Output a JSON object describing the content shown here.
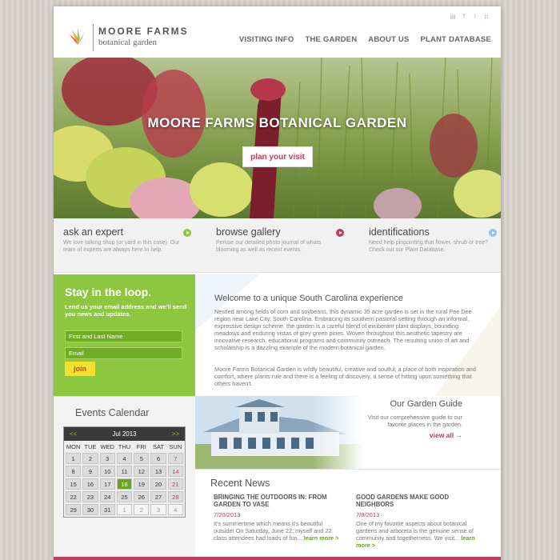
{
  "brand": {
    "title": "MOORE FARMS",
    "subtitle": "botanical garden"
  },
  "social": [
    "rss-icon",
    "facebook-icon",
    "twitter-icon",
    "pinterest-icon"
  ],
  "nav": [
    "VISITING INFO",
    "THE GARDEN",
    "ABOUT US",
    "PLANT DATABASE"
  ],
  "hero": {
    "title": "MOORE FARMS BOTANICAL GARDEN",
    "button": "plan your visit"
  },
  "features": [
    {
      "title": "ask an expert",
      "text": "We love talking shop (or yard in this case). Our team of experts are always here to help.",
      "color": "#8dc63f"
    },
    {
      "title": "browse gallery",
      "text": "Peruse our detailed photo journal of whats blooming as well as recent events.",
      "color": "#c33a5a"
    },
    {
      "title": "identifications",
      "text": "Need help pinpointing that flower, shrub or tree? Check out our Plant Database.",
      "color": "#8ec5e8"
    }
  ],
  "signup": {
    "title": "Stay in the loop.",
    "text": "Lend us your email address and we'll send you news and updates.",
    "name_placeholder": "First and Last Name",
    "email_placeholder": "Email",
    "button": "join"
  },
  "events": {
    "title": "Events Calendar",
    "month": "Jul 2013",
    "prev": "<<",
    "next": ">>",
    "dow": [
      "MON",
      "TUE",
      "WED",
      "THU",
      "FRI",
      "SAT",
      "SUN"
    ],
    "days": [
      "1",
      "2",
      "3",
      "4",
      "5",
      "6",
      "7",
      "8",
      "9",
      "10",
      "11",
      "12",
      "13",
      "14",
      "15",
      "16",
      "17",
      "18",
      "19",
      "20",
      "21",
      "22",
      "23",
      "24",
      "25",
      "26",
      "27",
      "28",
      "29",
      "30",
      "31",
      "1",
      "2",
      "3",
      "4"
    ]
  },
  "welcome": {
    "title": "Welcome to a unique South Carolina experience",
    "p1": "Nestled among fields of corn and soybeans, this dynamic 35 acre garden is set in the rural Pee Dee region near Lake City, South Carolina. Embracing its southern pastoral setting through an informal, expressive design scheme, the garden is a careful blend of exuberant plant displays, bounding meadows and enduring vistas of grey green pines. Woven throughout this aesthetic tapestry are innovative research, educational programs and community outreach. The resulting union of art and scholarship is a dazzling example of the modern botanical garden.",
    "p2": "Moore Farms Botanical Garden is wildly beautiful, creative and soulful; a place of both inspiration and comfort, where plants rule and there is a feeling of discovery, a sense of hitting upon something that others haven't."
  },
  "guide": {
    "title": "Our Garden Guide",
    "text": "Visit our comprehensive guide to our favorite places in the garden.",
    "link": "view all →"
  },
  "news": {
    "title": "Recent News",
    "items": [
      {
        "title": "BRINGING THE OUTDOORS IN: FROM GARDEN TO VASE",
        "date": "7/20/2013",
        "text": "It's summertime which means it's beautiful outside! On Saturday, June 22, myself and 22 class attendees had loads of fun... ",
        "more": "learn more >"
      },
      {
        "title": "GOOD GARDENS MAKE GOOD NEIGHBORS",
        "date": "7/8/2013",
        "text": "One of my favorite aspects about botanical gardens and arboreta is the genuine sense of community and togetherness.  We visit... ",
        "more": "learn more >"
      }
    ]
  }
}
